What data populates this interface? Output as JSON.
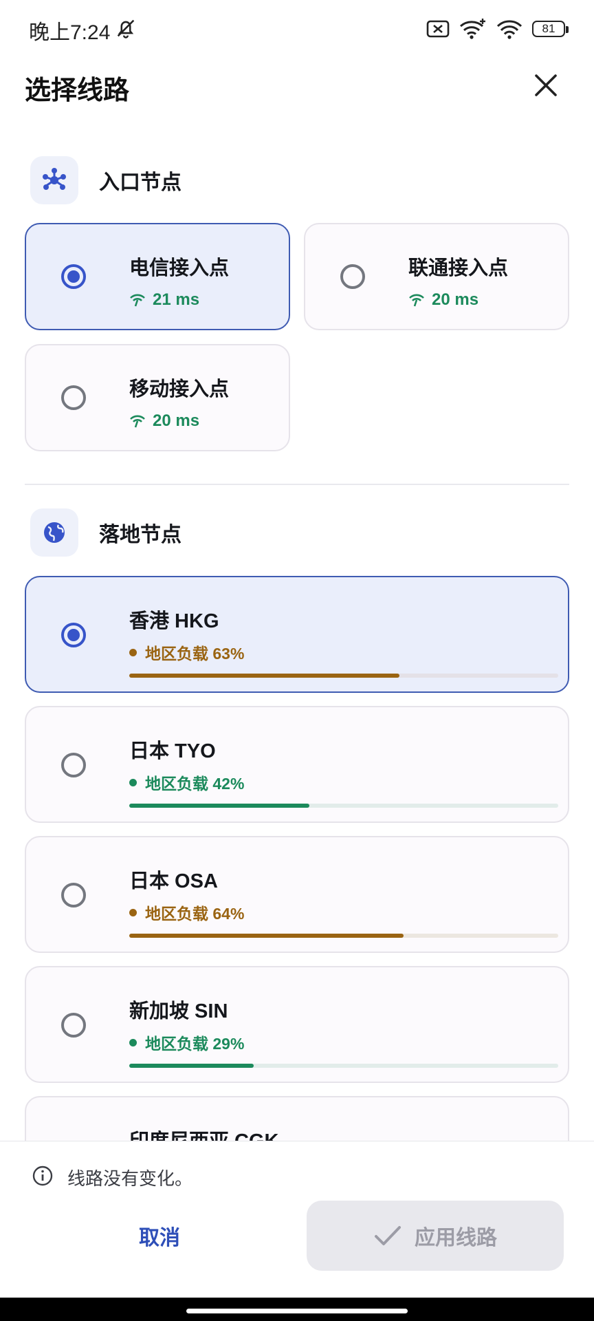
{
  "status_bar": {
    "time": "晚上7:24",
    "battery": "81"
  },
  "header": {
    "title": "选择线路"
  },
  "entry_section": {
    "title": "入口节点",
    "nodes": [
      {
        "name": "电信接入点",
        "latency": "21 ms",
        "selected": true
      },
      {
        "name": "联通接入点",
        "latency": "20 ms",
        "selected": false
      },
      {
        "name": "移动接入点",
        "latency": "20 ms",
        "selected": false
      }
    ]
  },
  "landing_section": {
    "title": "落地节点",
    "nodes": [
      {
        "name": "香港 HKG",
        "load_text": "地区负载 63%",
        "load": 0.63,
        "color": "#9a6412",
        "selected": true
      },
      {
        "name": "日本 TYO",
        "load_text": "地区负载 42%",
        "load": 0.42,
        "color": "#1c8a5c",
        "selected": false
      },
      {
        "name": "日本 OSA",
        "load_text": "地区负载 64%",
        "load": 0.64,
        "color": "#9a6412",
        "selected": false
      },
      {
        "name": "新加坡 SIN",
        "load_text": "地区负载 29%",
        "load": 0.29,
        "color": "#1c8a5c",
        "selected": false
      },
      {
        "name": "印度尼西亚 CGK",
        "selected": false
      }
    ]
  },
  "footer": {
    "status_message": "线路没有变化。",
    "cancel_label": "取消",
    "apply_label": "应用线路"
  },
  "colors": {
    "accent": "#3754c9",
    "green": "#1c8a5c",
    "amber": "#9a6412"
  }
}
